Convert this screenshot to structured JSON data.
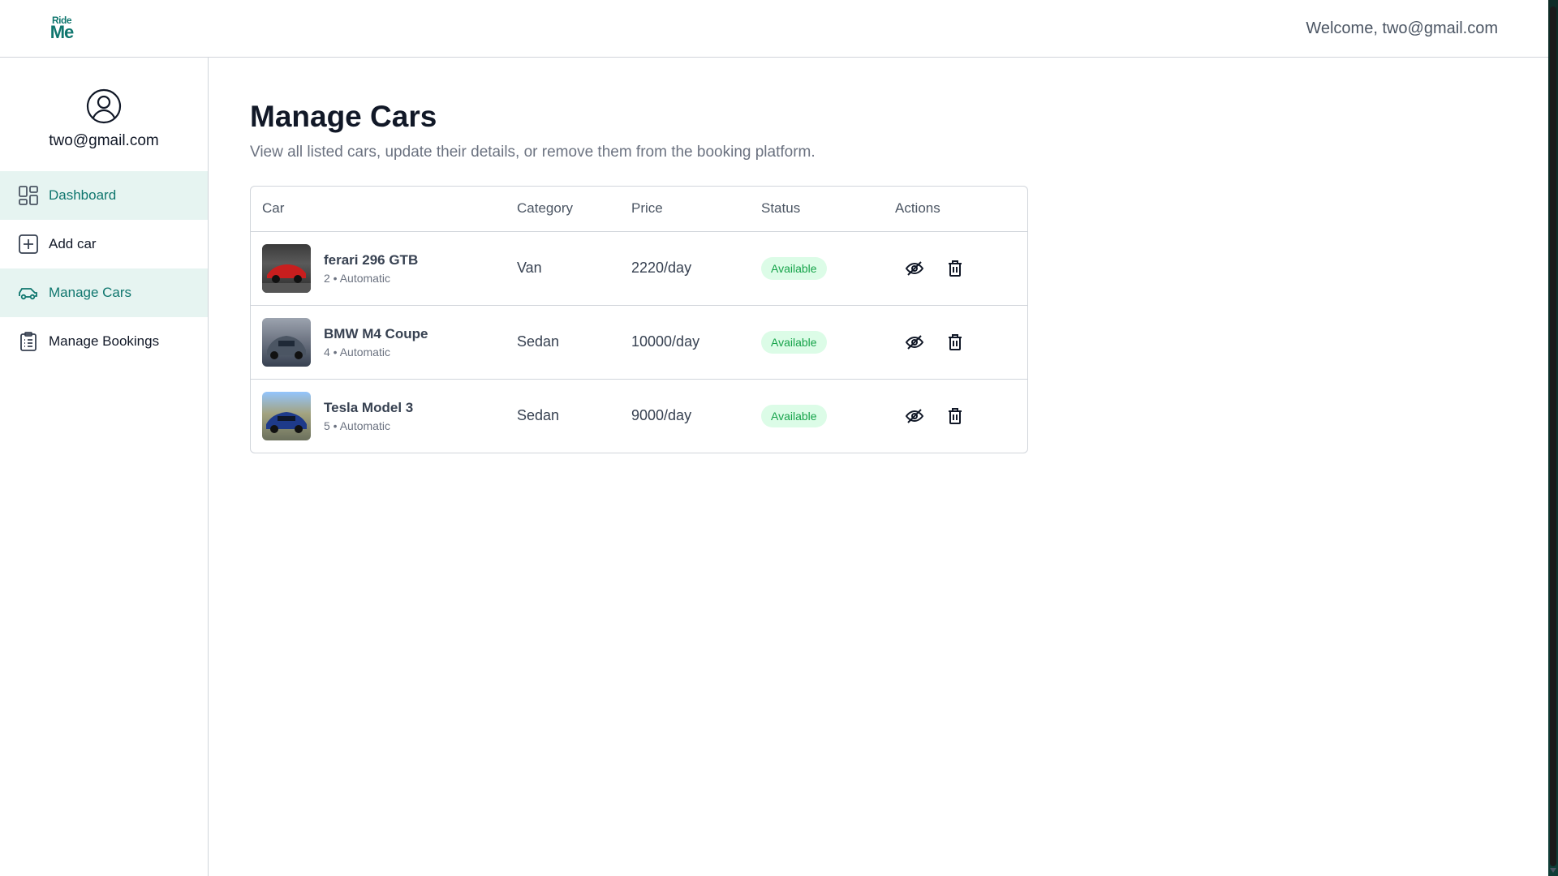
{
  "header": {
    "logo_top": "Ride",
    "logo_bottom": "Me",
    "welcome": "Welcome, two@gmail.com"
  },
  "sidebar": {
    "email": "two@gmail.com",
    "items": [
      {
        "label": "Dashboard",
        "icon": "dashboard-icon"
      },
      {
        "label": "Add car",
        "icon": "add-square-icon"
      },
      {
        "label": "Manage Cars",
        "icon": "car-icon"
      },
      {
        "label": "Manage Bookings",
        "icon": "clipboard-icon"
      }
    ]
  },
  "main": {
    "title": "Manage Cars",
    "subtitle": "View all listed cars, update their details, or remove them from the booking platform.",
    "columns": [
      "Car",
      "Category",
      "Price",
      "Status",
      "Actions"
    ],
    "rows": [
      {
        "name": "ferari 296 GTB",
        "meta": "2 • Automatic",
        "category": "Van",
        "price": "2220/day",
        "status": "Available",
        "thumb_color": "#b91c1c"
      },
      {
        "name": "BMW M4 Coupe",
        "meta": "4 • Automatic",
        "category": "Sedan",
        "price": "10000/day",
        "status": "Available",
        "thumb_color": "#6b7280"
      },
      {
        "name": "Tesla Model 3",
        "meta": "5 • Automatic",
        "category": "Sedan",
        "price": "9000/day",
        "status": "Available",
        "thumb_color": "#1e3a8a"
      }
    ]
  },
  "colors": {
    "brand": "#0f766e",
    "active_bg": "#e6f4f1",
    "badge_bg": "#dcfce7",
    "badge_text": "#16a34a"
  }
}
